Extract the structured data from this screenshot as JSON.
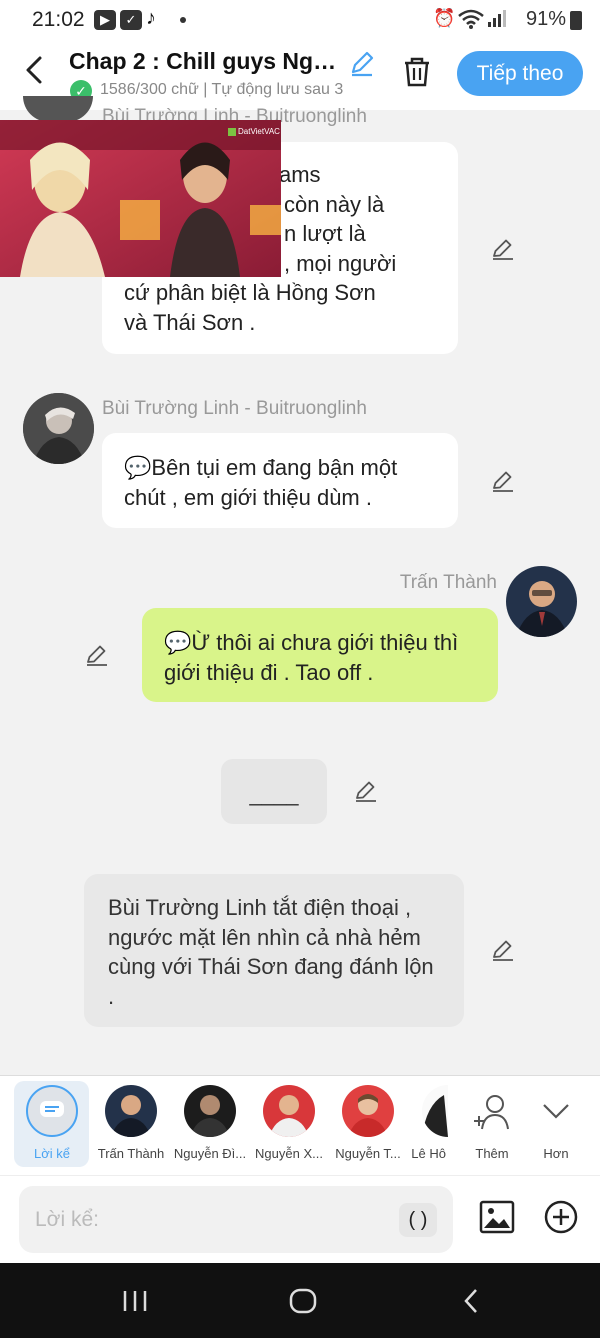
{
  "status": {
    "time": "21:02",
    "battery": "91%"
  },
  "header": {
    "title": "Chap 2 : Chill guys Ngo...",
    "subtitle": "1586/300 chữ | Tự động lưu sau 3",
    "next_button": "Tiếp theo",
    "accent_color": "#49a3f2"
  },
  "video": {
    "watermark": "DatVietVAC"
  },
  "messages": [
    {
      "sender": "Bùi Trường Linh - Buitruonglinh",
      "lines": [
        "ams",
        "còn này là",
        "n lượt là",
        ", mọi người",
        "cứ phân biệt là Hồng Sơn",
        "và Thái Sơn ."
      ]
    },
    {
      "sender": "Bùi Trường Linh - Buitruonglinh",
      "text": "💬Bên tụi em đang bận một chút , em giới thiệu dùm ."
    },
    {
      "sender": "Trấn Thành",
      "text": "💬Ừ thôi ai chưa giới thiệu thì giới thiệu đi . Tao off ."
    },
    {
      "text": "____"
    },
    {
      "text": "Bùi Trường Linh tắt điện thoại , ngước mặt lên nhìn cả nhà hẻm cùng với Thái Sơn đang đánh lộn ."
    }
  ],
  "characters": [
    {
      "label": "Lời kể",
      "icon": "narration-icon"
    },
    {
      "label": "Trấn Thành"
    },
    {
      "label": "Nguyễn Đì..."
    },
    {
      "label": "Nguyễn X..."
    },
    {
      "label": "Nguyễn T..."
    },
    {
      "label": "Lê Hô"
    },
    {
      "label": "Thêm",
      "icon": "add-person-icon"
    },
    {
      "label": "Hơn",
      "icon": "chevron-down-icon"
    }
  ],
  "input": {
    "placeholder": "Lời kể:",
    "paren": "( )"
  },
  "colors": {
    "user_bubble": "#d9f48a",
    "narration_bubble": "#e8e8e8"
  }
}
